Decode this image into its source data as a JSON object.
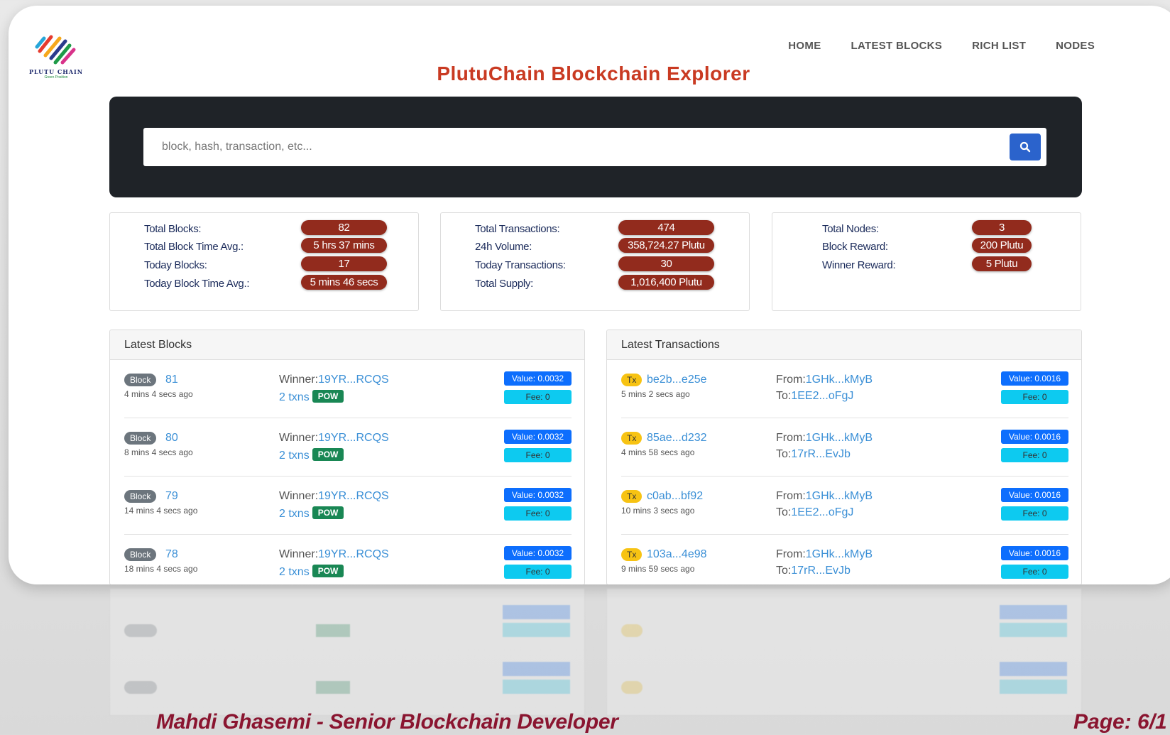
{
  "logo": {
    "text": "PLUTU CHAIN",
    "subtext": "Green Position"
  },
  "nav": [
    "HOME",
    "LATEST BLOCKS",
    "RICH LIST",
    "NODES"
  ],
  "title": "PlutuChain Blockchain Explorer",
  "search": {
    "placeholder": "block, hash, transaction, etc..."
  },
  "stats": [
    {
      "items": [
        {
          "label": "Total Blocks:",
          "value": "82"
        },
        {
          "label": "Total Block Time Avg.:",
          "value": "5 hrs 37 mins"
        },
        {
          "label": "Today Blocks:",
          "value": "17"
        },
        {
          "label": "Today Block Time Avg.:",
          "value": "5 mins 46 secs"
        }
      ]
    },
    {
      "items": [
        {
          "label": "Total Transactions:",
          "value": "474"
        },
        {
          "label": "24h Volume:",
          "value": "358,724.27 Plutu"
        },
        {
          "label": "Today Transactions:",
          "value": "30"
        },
        {
          "label": "Total Supply:",
          "value": "1,016,400 Plutu"
        }
      ]
    },
    {
      "items": [
        {
          "label": "Total Nodes:",
          "value": "3"
        },
        {
          "label": "Block Reward:",
          "value": "200 Plutu"
        },
        {
          "label": "Winner Reward:",
          "value": "5 Plutu"
        }
      ]
    }
  ],
  "latest_blocks": {
    "title": "Latest Blocks",
    "badge": "Block",
    "winner_label": "Winner:",
    "pow_label": "POW",
    "rows": [
      {
        "id": "81",
        "ago": "4 mins 4 secs ago",
        "winner": "19YR...RCQS",
        "txns": "2 txns",
        "value": "Value: 0.0032",
        "fee": "Fee: 0"
      },
      {
        "id": "80",
        "ago": "8 mins 4 secs ago",
        "winner": "19YR...RCQS",
        "txns": "2 txns",
        "value": "Value: 0.0032",
        "fee": "Fee: 0"
      },
      {
        "id": "79",
        "ago": "14 mins 4 secs ago",
        "winner": "19YR...RCQS",
        "txns": "2 txns",
        "value": "Value: 0.0032",
        "fee": "Fee: 0"
      },
      {
        "id": "78",
        "ago": "18 mins 4 secs ago",
        "winner": "19YR...RCQS",
        "txns": "2 txns",
        "value": "Value: 0.0032",
        "fee": "Fee: 0"
      }
    ]
  },
  "latest_transactions": {
    "title": "Latest Transactions",
    "badge": "Tx",
    "from_label": "From:",
    "to_label": "To:",
    "rows": [
      {
        "hash": "be2b...e25e",
        "ago": "5 mins 2 secs ago",
        "from": "1GHk...kMyB",
        "to": "1EE2...oFgJ",
        "value": "Value: 0.0016",
        "fee": "Fee: 0"
      },
      {
        "hash": "85ae...d232",
        "ago": "4 mins 58 secs ago",
        "from": "1GHk...kMyB",
        "to": "17rR...EvJb",
        "value": "Value: 0.0016",
        "fee": "Fee: 0"
      },
      {
        "hash": "c0ab...bf92",
        "ago": "10 mins 3 secs ago",
        "from": "1GHk...kMyB",
        "to": "1EE2...oFgJ",
        "value": "Value: 0.0016",
        "fee": "Fee: 0"
      },
      {
        "hash": "103a...4e98",
        "ago": "9 mins 59 secs ago",
        "from": "1GHk...kMyB",
        "to": "17rR...EvJb",
        "value": "Value: 0.0016",
        "fee": "Fee: 0"
      }
    ]
  },
  "footer": {
    "author": "Mahdi Ghasemi - Senior Blockchain Developer",
    "page": "Page: 6/1"
  },
  "colors": {
    "title": "#c93a22",
    "stat_badge": "#922b1d",
    "search_button": "#2b63cc",
    "link": "#3a8fd6",
    "footer": "#8a1530"
  }
}
